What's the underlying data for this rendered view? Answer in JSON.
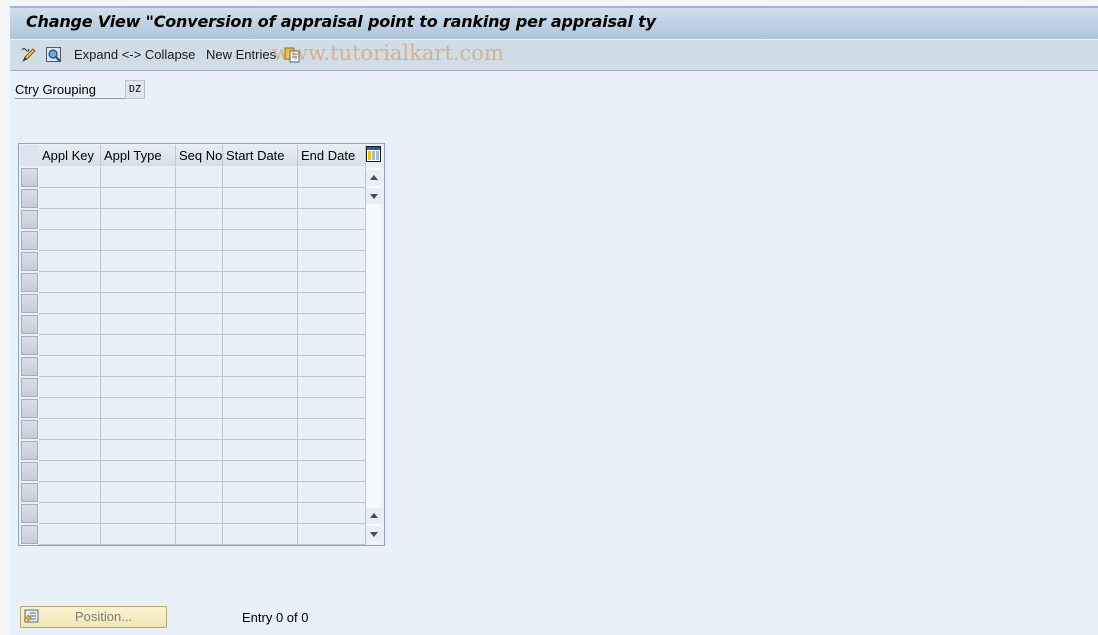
{
  "window": {
    "title": "Change View \"Conversion of appraisal point to ranking per appraisal ty"
  },
  "toolbar": {
    "items": [
      {
        "icon": "display-change-icon"
      },
      {
        "icon": "find-icon"
      },
      {
        "label": "Expand <-> Collapse"
      },
      {
        "label": "New Entries"
      },
      {
        "icon": "copy-icon"
      }
    ],
    "watermark": "www.tutorialkart.com"
  },
  "header_fields": {
    "ctry_grouping": {
      "label": "Ctry Grouping",
      "value": "DZ"
    }
  },
  "table": {
    "columns": [
      "Appl Key",
      "Appl Type",
      "Seq No",
      "Start Date",
      "End Date"
    ],
    "row_count_visible": 18,
    "rows": []
  },
  "footer": {
    "position_button": "Position...",
    "entry_status": "Entry 0 of 0"
  }
}
